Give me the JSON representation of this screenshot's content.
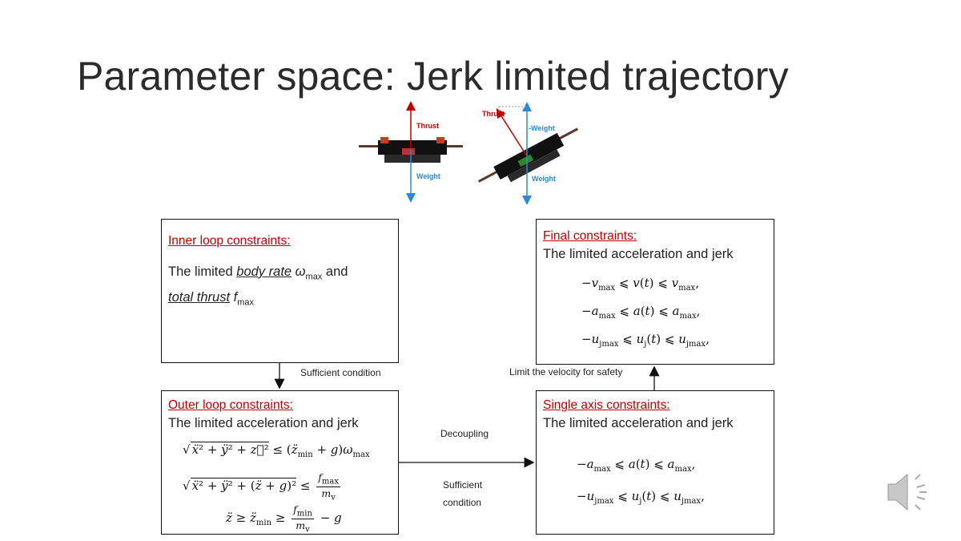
{
  "slide": {
    "title": "Parameter space: Jerk limited trajectory"
  },
  "drone_figure": {
    "left_drone": {
      "thrust_label": "Thrust",
      "weight_label": "Weight"
    },
    "right_drone": {
      "thrust_label": "Thrust",
      "neg_weight_label": "-Weight",
      "weight_label": "Weight"
    }
  },
  "inner_box": {
    "title": "Inner loop constraints:",
    "line1_prefix": "The limited ",
    "body_rate": "body rate",
    "omega": "ω",
    "omega_sub": "max",
    "and": " and",
    "total_thrust": "total thrust",
    "f": "f",
    "f_sub": "max"
  },
  "outer_box": {
    "title": "Outer loop constraints:",
    "subtitle": "The limited acceleration and jerk"
  },
  "final_box": {
    "title": "Final constraints:",
    "subtitle": "The limited acceleration and jerk"
  },
  "single_box": {
    "title": "Single axis constraints:",
    "subtitle": "The limited acceleration and jerk"
  },
  "connectors": {
    "sufficient_condition": "Sufficient condition",
    "limit_velocity": "Limit the velocity for safety",
    "decoupling": "Decoupling",
    "sufficient_line1": "Sufficient",
    "sufficient_line2": "condition"
  },
  "icons": {
    "speaker": "speaker-icon"
  }
}
